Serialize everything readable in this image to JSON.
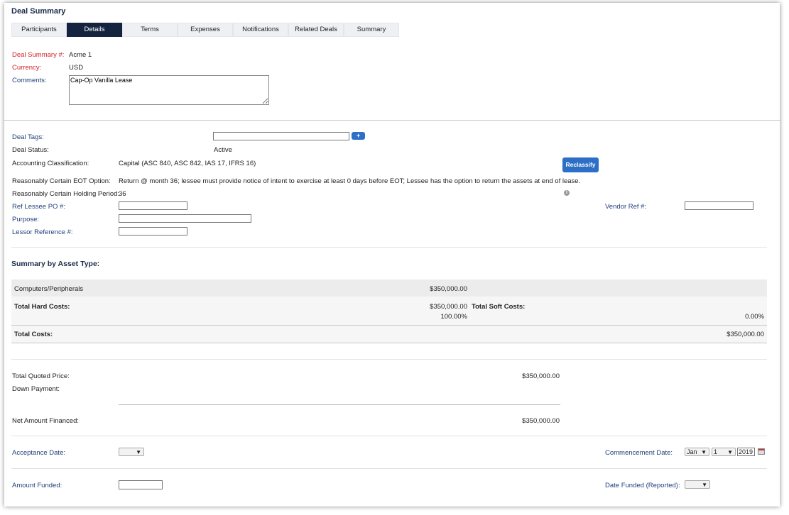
{
  "page": {
    "title": "Deal Summary"
  },
  "tabs": [
    "Participants",
    "Details",
    "Terms",
    "Expenses",
    "Notifications",
    "Related Deals",
    "Summary"
  ],
  "header_fields": {
    "deal_summary_label": "Deal Summary #:",
    "deal_summary_value": "Acme 1",
    "currency_label": "Currency:",
    "currency_value": "USD",
    "comments_label": "Comments:",
    "comments_value": "Cap-Op Vanilla Lease"
  },
  "details": {
    "deal_tags_label": "Deal Tags:",
    "add_tag_label": "+",
    "deal_status_label": "Deal Status:",
    "deal_status_value": "Active",
    "accounting_label": "Accounting Classification:",
    "accounting_value": "Capital (ASC 840, ASC 842, IAS 17, IFRS 16)",
    "reclassify_label": "Reclassify",
    "eot_label": "Reasonably Certain EOT Option:",
    "eot_value": "Return @ month 36; lessee must provide notice of intent to exercise at least 0 days before EOT; Lessee has the option to return the assets at end of lease.",
    "holding_label": "Reasonably Certain Holding Period:",
    "holding_value": "36",
    "ref_lessee_label": "Ref Lessee PO #:",
    "vendor_ref_label": "Vendor Ref #:",
    "purpose_label": "Purpose:",
    "lessor_ref_label": "Lessor Reference #:",
    "info_icon": "i"
  },
  "asset_summary": {
    "heading": "Summary by Asset Type:",
    "row_label": "Computers/Peripherals",
    "row_value": "$350,000.00",
    "hard_label": "Total Hard Costs:",
    "hard_value": "$350,000.00",
    "hard_pct": "100.00%",
    "soft_label": "Total Soft Costs:",
    "soft_pct": "0.00%",
    "total_label": "Total Costs:",
    "total_value": "$350,000.00"
  },
  "financing": {
    "quoted_label": "Total Quoted Price:",
    "quoted_value": "$350,000.00",
    "down_label": "Down Payment:",
    "net_label": "Net Amount Financed:",
    "net_value": "$350,000.00"
  },
  "dates": {
    "acceptance_label": "Acceptance Date:",
    "commencement_label": "Commencement Date:",
    "month": "Jan",
    "day": "1",
    "year": "2019",
    "amount_funded_label": "Amount Funded:",
    "date_funded_label": "Date Funded (Reported):"
  },
  "colors": {
    "navy": "#14243f",
    "accent_blue": "#2d6fc6",
    "label_red": "#d32027",
    "label_blue": "#1f3f7a"
  }
}
